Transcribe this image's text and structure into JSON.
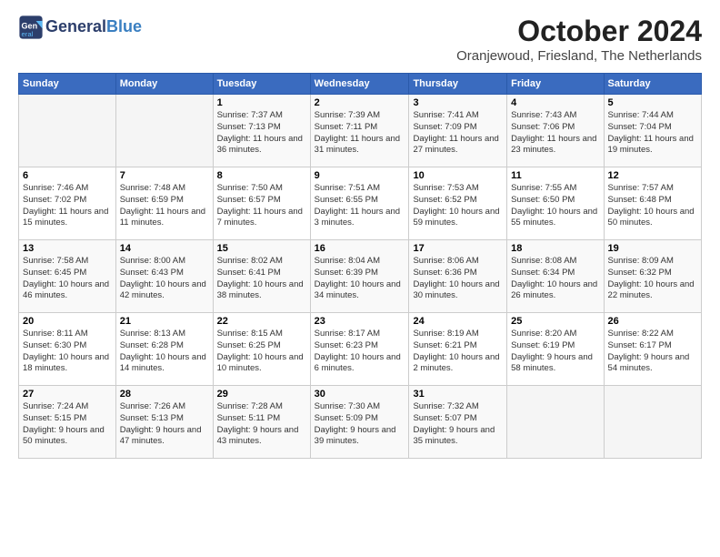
{
  "header": {
    "logo_line1": "General",
    "logo_line2": "Blue",
    "month": "October 2024",
    "location": "Oranjewoud, Friesland, The Netherlands"
  },
  "weekdays": [
    "Sunday",
    "Monday",
    "Tuesday",
    "Wednesday",
    "Thursday",
    "Friday",
    "Saturday"
  ],
  "weeks": [
    [
      {
        "day": "",
        "info": ""
      },
      {
        "day": "",
        "info": ""
      },
      {
        "day": "1",
        "info": "Sunrise: 7:37 AM\nSunset: 7:13 PM\nDaylight: 11 hours and 36 minutes."
      },
      {
        "day": "2",
        "info": "Sunrise: 7:39 AM\nSunset: 7:11 PM\nDaylight: 11 hours and 31 minutes."
      },
      {
        "day": "3",
        "info": "Sunrise: 7:41 AM\nSunset: 7:09 PM\nDaylight: 11 hours and 27 minutes."
      },
      {
        "day": "4",
        "info": "Sunrise: 7:43 AM\nSunset: 7:06 PM\nDaylight: 11 hours and 23 minutes."
      },
      {
        "day": "5",
        "info": "Sunrise: 7:44 AM\nSunset: 7:04 PM\nDaylight: 11 hours and 19 minutes."
      }
    ],
    [
      {
        "day": "6",
        "info": "Sunrise: 7:46 AM\nSunset: 7:02 PM\nDaylight: 11 hours and 15 minutes."
      },
      {
        "day": "7",
        "info": "Sunrise: 7:48 AM\nSunset: 6:59 PM\nDaylight: 11 hours and 11 minutes."
      },
      {
        "day": "8",
        "info": "Sunrise: 7:50 AM\nSunset: 6:57 PM\nDaylight: 11 hours and 7 minutes."
      },
      {
        "day": "9",
        "info": "Sunrise: 7:51 AM\nSunset: 6:55 PM\nDaylight: 11 hours and 3 minutes."
      },
      {
        "day": "10",
        "info": "Sunrise: 7:53 AM\nSunset: 6:52 PM\nDaylight: 10 hours and 59 minutes."
      },
      {
        "day": "11",
        "info": "Sunrise: 7:55 AM\nSunset: 6:50 PM\nDaylight: 10 hours and 55 minutes."
      },
      {
        "day": "12",
        "info": "Sunrise: 7:57 AM\nSunset: 6:48 PM\nDaylight: 10 hours and 50 minutes."
      }
    ],
    [
      {
        "day": "13",
        "info": "Sunrise: 7:58 AM\nSunset: 6:45 PM\nDaylight: 10 hours and 46 minutes."
      },
      {
        "day": "14",
        "info": "Sunrise: 8:00 AM\nSunset: 6:43 PM\nDaylight: 10 hours and 42 minutes."
      },
      {
        "day": "15",
        "info": "Sunrise: 8:02 AM\nSunset: 6:41 PM\nDaylight: 10 hours and 38 minutes."
      },
      {
        "day": "16",
        "info": "Sunrise: 8:04 AM\nSunset: 6:39 PM\nDaylight: 10 hours and 34 minutes."
      },
      {
        "day": "17",
        "info": "Sunrise: 8:06 AM\nSunset: 6:36 PM\nDaylight: 10 hours and 30 minutes."
      },
      {
        "day": "18",
        "info": "Sunrise: 8:08 AM\nSunset: 6:34 PM\nDaylight: 10 hours and 26 minutes."
      },
      {
        "day": "19",
        "info": "Sunrise: 8:09 AM\nSunset: 6:32 PM\nDaylight: 10 hours and 22 minutes."
      }
    ],
    [
      {
        "day": "20",
        "info": "Sunrise: 8:11 AM\nSunset: 6:30 PM\nDaylight: 10 hours and 18 minutes."
      },
      {
        "day": "21",
        "info": "Sunrise: 8:13 AM\nSunset: 6:28 PM\nDaylight: 10 hours and 14 minutes."
      },
      {
        "day": "22",
        "info": "Sunrise: 8:15 AM\nSunset: 6:25 PM\nDaylight: 10 hours and 10 minutes."
      },
      {
        "day": "23",
        "info": "Sunrise: 8:17 AM\nSunset: 6:23 PM\nDaylight: 10 hours and 6 minutes."
      },
      {
        "day": "24",
        "info": "Sunrise: 8:19 AM\nSunset: 6:21 PM\nDaylight: 10 hours and 2 minutes."
      },
      {
        "day": "25",
        "info": "Sunrise: 8:20 AM\nSunset: 6:19 PM\nDaylight: 9 hours and 58 minutes."
      },
      {
        "day": "26",
        "info": "Sunrise: 8:22 AM\nSunset: 6:17 PM\nDaylight: 9 hours and 54 minutes."
      }
    ],
    [
      {
        "day": "27",
        "info": "Sunrise: 7:24 AM\nSunset: 5:15 PM\nDaylight: 9 hours and 50 minutes."
      },
      {
        "day": "28",
        "info": "Sunrise: 7:26 AM\nSunset: 5:13 PM\nDaylight: 9 hours and 47 minutes."
      },
      {
        "day": "29",
        "info": "Sunrise: 7:28 AM\nSunset: 5:11 PM\nDaylight: 9 hours and 43 minutes."
      },
      {
        "day": "30",
        "info": "Sunrise: 7:30 AM\nSunset: 5:09 PM\nDaylight: 9 hours and 39 minutes."
      },
      {
        "day": "31",
        "info": "Sunrise: 7:32 AM\nSunset: 5:07 PM\nDaylight: 9 hours and 35 minutes."
      },
      {
        "day": "",
        "info": ""
      },
      {
        "day": "",
        "info": ""
      }
    ]
  ]
}
